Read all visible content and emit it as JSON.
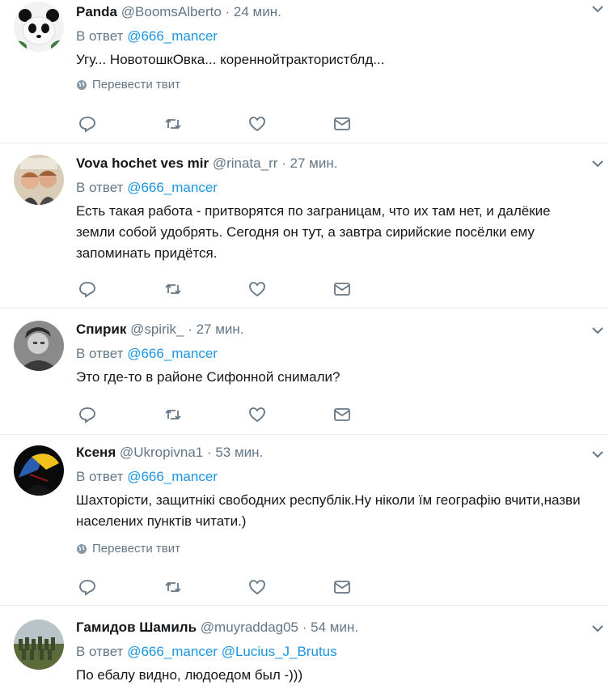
{
  "common": {
    "reply_prefix": "В ответ",
    "translate_label": "Перевести твит"
  },
  "tweets": [
    {
      "name": "Panda",
      "handle": "@BoomsAlberto",
      "time": "· 24 мин.",
      "reply_to": "@666_mancer",
      "text": "Угу... НовотошкОвка... кореннойтрактористблд...",
      "translate": true
    },
    {
      "name": "Vova hochet ves mir",
      "handle": "@rinata_rr",
      "time": "· 27 мин.",
      "reply_to": "@666_mancer",
      "text": "Есть такая работа - притворятся по заграницам, что их там нет, и далёкие земли собой удобрять. Сегодня он тут, а завтра сирийские посёлки ему запоминать придётся.",
      "translate": false
    },
    {
      "name": "Спирик",
      "handle": "@spirik_",
      "time": "· 27 мин.",
      "reply_to": "@666_mancer",
      "text": "Это где-то в районе Сифонной снимали?",
      "translate": false
    },
    {
      "name": "Ксеня",
      "handle": "@Ukropivna1",
      "time": "· 53 мин.",
      "reply_to": "@666_mancer",
      "text": "Шахторісти, защитнікі свободних республік.Ну ніколи їм географію вчити,назви населених пунктів читати.)",
      "translate": true
    },
    {
      "name": "Гамидов Шамиль",
      "handle": "@muyraddag05",
      "time": "· 54 мин.",
      "reply_to": "@666_mancer",
      "reply_to_2": "@Lucius_J_Brutus",
      "text": "По ебалу видно, людоедом был -)))",
      "translate": false
    }
  ],
  "colors": {
    "name": "#14171a",
    "meta": "#657786",
    "mention": "#1b95e0",
    "border": "#e6ecf0"
  }
}
